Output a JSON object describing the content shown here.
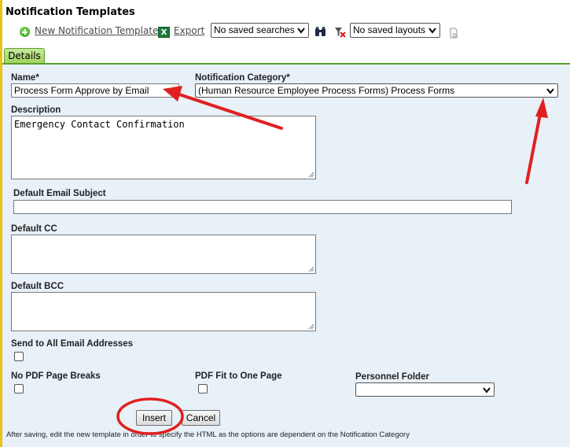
{
  "header": {
    "title": "Notification Templates"
  },
  "toolbar": {
    "new_template_label": "New Notification Template",
    "export_label": "Export",
    "saved_searches": "No saved searches",
    "saved_layouts": "No saved layouts",
    "icons": [
      "add-icon",
      "excel-icon",
      "binoculars-icon",
      "clear-filter-icon",
      "document-icon"
    ]
  },
  "tabs": [
    {
      "label": "Details",
      "active": true
    }
  ],
  "form": {
    "name_label": "Name*",
    "name_value": "Process Form Approve by Email",
    "category_label": "Notification Category*",
    "category_value": "(Human Resource Employee Process Forms) Process Forms",
    "description_label": "Description",
    "description_value": "Emergency Contact Confirmation",
    "email_subject_label": "Default Email Subject",
    "email_subject_value": "",
    "cc_label": "Default CC",
    "cc_value": "",
    "bcc_label": "Default BCC",
    "bcc_value": "",
    "send_all_label": "Send to All Email Addresses",
    "send_all_checked": false,
    "no_pdf_breaks_label": "No PDF Page Breaks",
    "no_pdf_breaks_checked": false,
    "pdf_fit_label": "PDF Fit to One Page",
    "pdf_fit_checked": false,
    "personnel_folder_label": "Personnel Folder",
    "personnel_folder_value": ""
  },
  "buttons": {
    "insert": "Insert",
    "cancel": "Cancel"
  },
  "footer_note": "After saving, edit the new template in order to specify the HTML as the options are dependent on the Notification Category",
  "colors": {
    "accent_green": "#5aa02c",
    "panel_background": "#e8f0f8",
    "annotation_red": "#e02020"
  }
}
